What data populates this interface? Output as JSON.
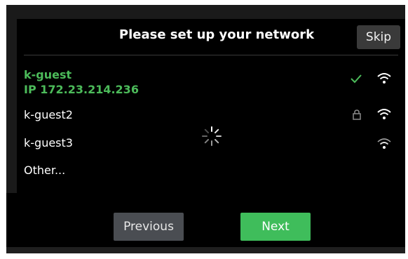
{
  "header": {
    "title": "Please set up your network",
    "skip_label": "Skip"
  },
  "networks": [
    {
      "name": "k-guest",
      "ip": "IP  172.23.214.236",
      "connected": true,
      "secured": false,
      "signal": "strong"
    },
    {
      "name": "k-guest2",
      "connected": false,
      "secured": true,
      "signal": "strong"
    },
    {
      "name": "k-guest3",
      "connected": false,
      "secured": false,
      "signal": "medium"
    },
    {
      "name": "Other...",
      "connected": false,
      "secured": false,
      "signal": "none"
    }
  ],
  "footer": {
    "previous_label": "Previous",
    "next_label": "Next"
  },
  "colors": {
    "background": "#000000",
    "accent_green": "#4cbb5a",
    "button_grey": "#4a4d52",
    "button_green": "#3fbd5b"
  },
  "icons": {
    "connected": "check-icon",
    "secured": "lock-icon",
    "signal": "wifi-icon",
    "loading": "spinner-icon"
  }
}
